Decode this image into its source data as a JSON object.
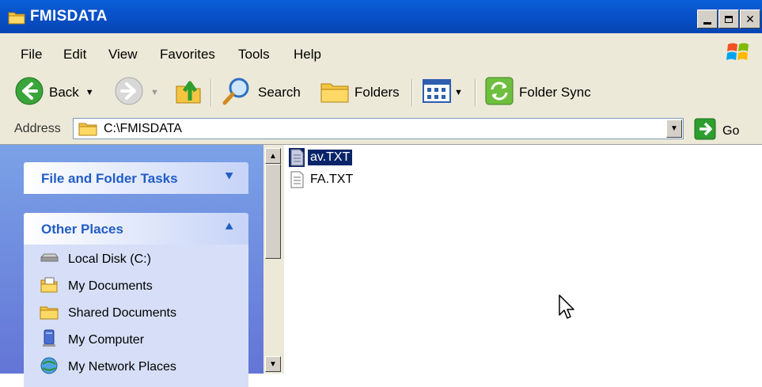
{
  "window": {
    "title": "FMISDATA",
    "controls": [
      "minimize",
      "maximize",
      "close"
    ]
  },
  "menu": {
    "items": [
      "File",
      "Edit",
      "View",
      "Favorites",
      "Tools",
      "Help"
    ]
  },
  "toolbar": {
    "back_label": "Back",
    "search_label": "Search",
    "folders_label": "Folders",
    "sync_label": "Folder Sync"
  },
  "address": {
    "label": "Address",
    "value": "C:\\FMISDATA",
    "go_label": "Go"
  },
  "tasks": {
    "file_folder_title": "File and Folder Tasks",
    "other_places_title": "Other Places",
    "places": [
      "Local Disk (C:)",
      "My Documents",
      "Shared Documents",
      "My Computer",
      "My Network Places"
    ]
  },
  "files": [
    {
      "name": "av.TXT",
      "selected": true
    },
    {
      "name": "FA.TXT",
      "selected": false
    }
  ],
  "colors": {
    "title_bar": "#0851c9",
    "task_pane": "#7ba2e7",
    "selection": "#0a246a"
  }
}
